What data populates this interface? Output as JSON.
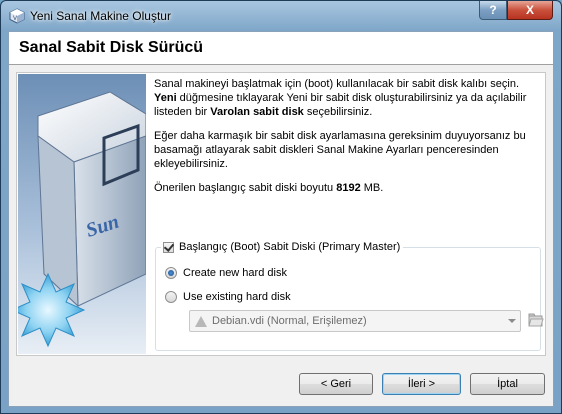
{
  "window": {
    "title": "Yeni Sanal Makine Oluştur",
    "help_label": "?",
    "close_label": "X"
  },
  "header": {
    "title": "Sanal Sabit Disk Sürücü"
  },
  "description": {
    "p1_a": "Sanal makineyi başlatmak için (boot) kullanılacak bir sabit disk kalıbı seçin. ",
    "p1_b": "Yeni",
    "p1_c": " düğmesine tıklayarak Yeni bir sabit disk oluşturabilirsiniz ya da açılabilir listeden bir ",
    "p1_d": "Varolan sabit disk",
    "p1_e": " seçebilirsiniz.",
    "p2": "Eğer daha karmaşık bir sabit disk ayarlamasına gereksinim duyuyorsanız bu basamağı atlayarak sabit diskleri Sanal Makine Ayarları penceresinden ekleyebilirsiniz.",
    "p3_a": "Önerilen başlangıç sabit diski boyutu ",
    "p3_size": "8192",
    "p3_unit": " MB."
  },
  "boot_disk": {
    "checkbox_label": "Başlangıç (Boot) Sabit Diski (Primary Master)",
    "checked": true,
    "create_label": "Create new hard disk",
    "existing_label": "Use existing hard disk",
    "selected": "create",
    "disk_value": "Debian.vdi (Normal, Erişilemez)"
  },
  "buttons": {
    "back": "< Geri",
    "next": "İleri >",
    "cancel": "İptal"
  },
  "colors": {
    "accent": "#3c7fb1",
    "title_close": "#c9513c"
  }
}
